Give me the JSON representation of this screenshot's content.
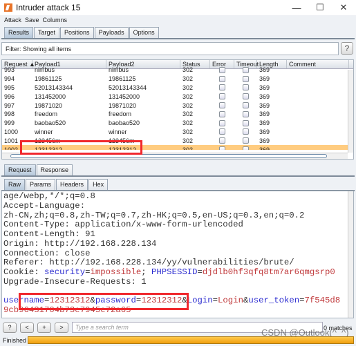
{
  "window": {
    "title": "Intruder attack 15",
    "minimize": "—",
    "maximize": "☐",
    "close": "✕"
  },
  "menu": [
    "Attack",
    "Save",
    "Columns"
  ],
  "tabs": [
    "Results",
    "Target",
    "Positions",
    "Payloads",
    "Options"
  ],
  "active_tab": "Results",
  "filter": {
    "text": "Filter: Showing all items",
    "help": "?"
  },
  "table": {
    "columns": [
      "Request ▲",
      "Payload1",
      "Payload2",
      "Status",
      "Error",
      "Timeout",
      "Length",
      "Comment"
    ],
    "rows": [
      {
        "req": "993",
        "p1": "nimbus",
        "p2": "nimbus",
        "status": "302",
        "len": "369"
      },
      {
        "req": "994",
        "p1": "19861125",
        "p2": "19861125",
        "status": "302",
        "len": "369"
      },
      {
        "req": "995",
        "p1": "52013143344",
        "p2": "52013143344",
        "status": "302",
        "len": "369"
      },
      {
        "req": "996",
        "p1": "131452000",
        "p2": "131452000",
        "status": "302",
        "len": "369"
      },
      {
        "req": "997",
        "p1": "19871020",
        "p2": "19871020",
        "status": "302",
        "len": "369"
      },
      {
        "req": "998",
        "p1": "freedom",
        "p2": "freedom",
        "status": "302",
        "len": "369"
      },
      {
        "req": "999",
        "p1": "baobao520",
        "p2": "baobao520",
        "status": "302",
        "len": "369"
      },
      {
        "req": "1000",
        "p1": "winner",
        "p2": "winner",
        "status": "302",
        "len": "369"
      },
      {
        "req": "1001",
        "p1": "123456m",
        "p2": "123456m",
        "status": "302",
        "len": "369"
      },
      {
        "req": "1002",
        "p1": "12312312",
        "p2": "12312312",
        "status": "302",
        "len": "369",
        "selected": true
      }
    ]
  },
  "msg_tabs": [
    "Request",
    "Response"
  ],
  "view_tabs": [
    "Raw",
    "Params",
    "Headers",
    "Hex"
  ],
  "request_lines": [
    [
      [
        "t",
        "age/webp,*/*;q=0.8"
      ]
    ],
    [
      [
        "t",
        "Accept-Language:"
      ]
    ],
    [
      [
        "t",
        "zh-CN,zh;q=0.8,zh-TW;q=0.7,zh-HK;q=0.5,en-US;q=0.3,en;q=0.2"
      ]
    ],
    [
      [
        "t",
        "Content-Type: application/x-www-form-urlencoded"
      ]
    ],
    [
      [
        "t",
        "Content-Length: 91"
      ]
    ],
    [
      [
        "t",
        "Origin: http://192.168.228.134"
      ]
    ],
    [
      [
        "t",
        "Connection: close"
      ]
    ],
    [
      [
        "t",
        "Referer: http://192.168.228.134/yy/vulnerabilities/brute/"
      ]
    ],
    [
      [
        "t",
        "Cookie: "
      ],
      [
        "k",
        "security"
      ],
      [
        "t",
        "="
      ],
      [
        "v",
        "impossible"
      ],
      [
        "t",
        "; "
      ],
      [
        "k",
        "PHPSESSID"
      ],
      [
        "t",
        "="
      ],
      [
        "v",
        "djdlb0hf3qfq8tm7ar6qmgsrp0"
      ]
    ],
    [
      [
        "t",
        "Upgrade-Insecure-Requests: 1"
      ]
    ],
    [
      [
        "t",
        ""
      ]
    ],
    [
      [
        "k",
        "username"
      ],
      [
        "t",
        "="
      ],
      [
        "v",
        "12312312"
      ],
      [
        "t",
        "&"
      ],
      [
        "k",
        "password"
      ],
      [
        "t",
        "="
      ],
      [
        "v",
        "12312312"
      ],
      [
        "t",
        "&"
      ],
      [
        "k",
        "Login"
      ],
      [
        "t",
        "="
      ],
      [
        "v",
        "Login"
      ],
      [
        "t",
        "&"
      ],
      [
        "k",
        "user_token"
      ],
      [
        "t",
        "="
      ],
      [
        "v",
        "7f545d8"
      ]
    ],
    [
      [
        "v",
        "9cb96431704b73e7945e72a65"
      ]
    ]
  ],
  "search": {
    "buttons": [
      "?",
      "<",
      "+",
      ">"
    ],
    "placeholder": "Type a search term",
    "matches": "0 matches"
  },
  "status": {
    "text": "Finished",
    "progress_percent": 100
  },
  "watermark": "CSDN @Outlook(^_^)",
  "colors": {
    "selected_row": "#ffcc80",
    "highlight_box": "#f0282d",
    "progress": "#f0a010",
    "param_name": "#2c2cd0",
    "param_value": "#c0393b"
  }
}
